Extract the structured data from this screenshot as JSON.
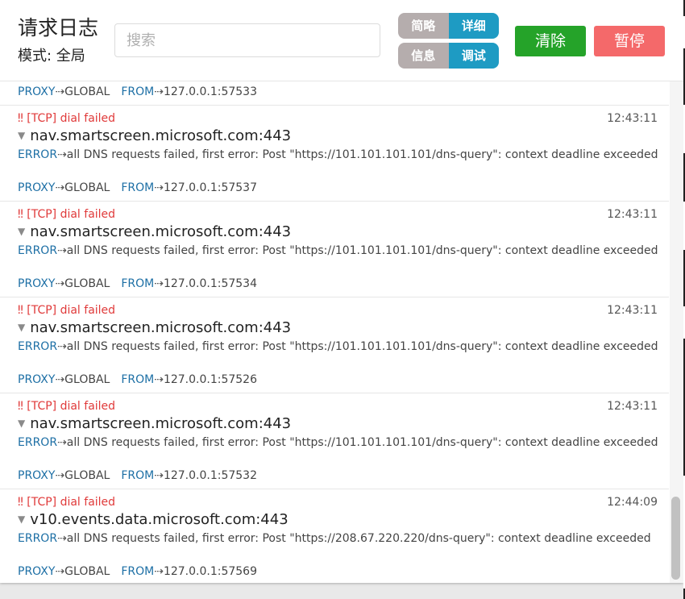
{
  "header": {
    "title": "请求日志",
    "mode": "模式: 全局",
    "search_placeholder": "搜索",
    "seg_brief": "简略",
    "seg_detail": "详细",
    "seg_info": "信息",
    "seg_debug": "调试",
    "clear_label": "清除",
    "pause_label": "暂停"
  },
  "labels": {
    "proxy": "PROXY",
    "from": "FROM",
    "error": "ERROR",
    "arrow": "⇢",
    "triangle": "▼"
  },
  "top_partial": {
    "proxy_target": "GLOBAL",
    "from_addr": "127.0.0.1:57533"
  },
  "entries": [
    {
      "title": "‼ [TCP] dial failed",
      "time": "12:43:11",
      "host": "nav.smartscreen.microsoft.com:443",
      "error": "all DNS requests failed, first error: Post \"https://101.101.101.101/dns-query\": context deadline exceeded",
      "proxy_target": "GLOBAL",
      "from_addr": "127.0.0.1:57537"
    },
    {
      "title": "‼ [TCP] dial failed",
      "time": "12:43:11",
      "host": "nav.smartscreen.microsoft.com:443",
      "error": "all DNS requests failed, first error: Post \"https://101.101.101.101/dns-query\": context deadline exceeded",
      "proxy_target": "GLOBAL",
      "from_addr": "127.0.0.1:57534"
    },
    {
      "title": "‼ [TCP] dial failed",
      "time": "12:43:11",
      "host": "nav.smartscreen.microsoft.com:443",
      "error": "all DNS requests failed, first error: Post \"https://101.101.101.101/dns-query\": context deadline exceeded",
      "proxy_target": "GLOBAL",
      "from_addr": "127.0.0.1:57526"
    },
    {
      "title": "‼ [TCP] dial failed",
      "time": "12:43:11",
      "host": "nav.smartscreen.microsoft.com:443",
      "error": "all DNS requests failed, first error: Post \"https://101.101.101.101/dns-query\": context deadline exceeded",
      "proxy_target": "GLOBAL",
      "from_addr": "127.0.0.1:57532"
    },
    {
      "title": "‼ [TCP] dial failed",
      "time": "12:44:09",
      "host": "v10.events.data.microsoft.com:443",
      "error": "all DNS requests failed, first error: Post \"https://208.67.220.220/dns-query\": context deadline exceeded",
      "proxy_target": "GLOBAL",
      "from_addr": "127.0.0.1:57569"
    }
  ],
  "colors": {
    "error_red": "#e03a3a",
    "keyword_blue": "#1d6fa5",
    "clear_green": "#25a329",
    "pause_red": "#f4696a",
    "seg_gray": "#b5adad",
    "seg_blue": "#1e9bc3"
  }
}
